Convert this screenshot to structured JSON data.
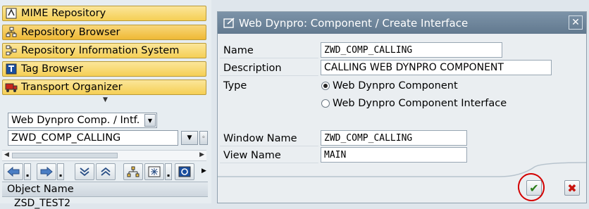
{
  "nav": {
    "buttons": [
      {
        "label": "MIME Repository",
        "icon": "mime-repository-icon"
      },
      {
        "label": "Repository Browser",
        "icon": "repository-browser-icon"
      },
      {
        "label": "Repository Information System",
        "icon": "repository-info-system-icon"
      },
      {
        "label": "Tag Browser",
        "icon": "tag-browser-icon"
      },
      {
        "label": "Transport Organizer",
        "icon": "transport-organizer-icon"
      }
    ],
    "object_type": "Web Dynpro Comp. / Intf.",
    "object_name": "ZWD_COMP_CALLING",
    "column_header": "Object Name",
    "tree_row": "ZSD_TEST2"
  },
  "dialog": {
    "title": "Web Dynpro: Component / Create Interface",
    "fields": {
      "name_label": "Name",
      "name_value": "ZWD_COMP_CALLING",
      "description_label": "Description",
      "description_value": "CALLING WEB DYNPRO COMPONENT",
      "type_label": "Type",
      "type_option_component": "Web Dynpro Component",
      "type_option_interface": "Web Dynpro Component Interface",
      "selected_type": "Web Dynpro Component",
      "window_label": "Window Name",
      "window_value": "ZWD_COMP_CALLING",
      "view_label": "View Name",
      "view_value": "MAIN"
    },
    "ok_symbol": "✔",
    "cancel_symbol": "✖",
    "close_symbol": "✕"
  },
  "colors": {
    "title_bar": "#6f869b",
    "nav_button": "#f5cf55",
    "ok_green": "#2a7d18",
    "cancel_red": "#c8130d",
    "highlight_ring": "#d30000"
  }
}
